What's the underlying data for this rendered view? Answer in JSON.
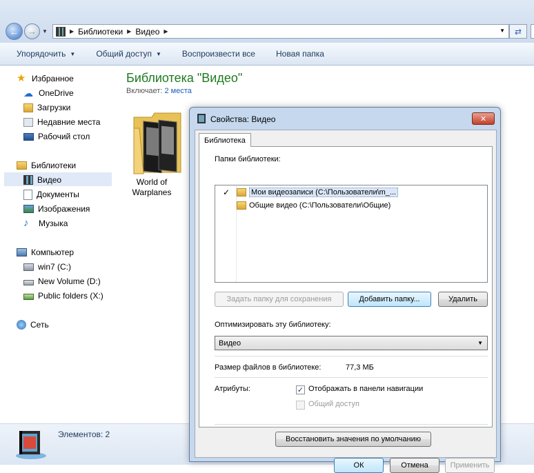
{
  "address": {
    "crumbs": [
      "Библиотеки",
      "Видео"
    ]
  },
  "toolbar": {
    "organize": "Упорядочить",
    "share": "Общий доступ",
    "play_all": "Воспроизвести все",
    "new_folder": "Новая папка"
  },
  "sidebar": {
    "favorites": "Избранное",
    "onedrive": "OneDrive",
    "downloads": "Загрузки",
    "recent": "Недавние места",
    "desktop": "Рабочий стол",
    "libraries": "Библиотеки",
    "video": "Видео",
    "documents": "Документы",
    "pictures": "Изображения",
    "music": "Музыка",
    "computer": "Компьютер",
    "drive_c": "win7 (C:)",
    "drive_d": "New Volume (D:)",
    "drive_x": "Public folders (X:)",
    "network": "Сеть"
  },
  "content": {
    "title": "Библиотека \"Видео\"",
    "includes_label": "Включает:",
    "includes_link": "2 места",
    "folder_line1": "World of",
    "folder_line2": "Warplanes"
  },
  "status": {
    "items": "Элементов: 2"
  },
  "dialog": {
    "title": "Свойства: Видео",
    "close": "✕",
    "tab": "Библиотека",
    "folders_label": "Папки библиотеки:",
    "folders": [
      {
        "check": "✓",
        "label": "Мои видеозаписи (C:\\Пользователи\\m_..."
      },
      {
        "check": "",
        "label": "Общие видео (C:\\Пользователи\\Общие)"
      }
    ],
    "set_save_btn": "Задать папку для сохранения",
    "add_folder_btn": "Добавить папку...",
    "remove_btn": "Удалить",
    "optimize_label": "Оптимизировать эту библиотеку:",
    "optimize_value": "Видео",
    "size_label": "Размер файлов в библиотеке:",
    "size_value": "77,3 МБ",
    "attributes_label": "Атрибуты:",
    "show_nav_check": "✓",
    "show_nav_label": "Отображать в панели навигации",
    "shared_label": "Общий доступ",
    "restore_btn": "Восстановить значения по умолчанию",
    "ok": "ОК",
    "cancel": "Отмена",
    "apply": "Применить"
  }
}
